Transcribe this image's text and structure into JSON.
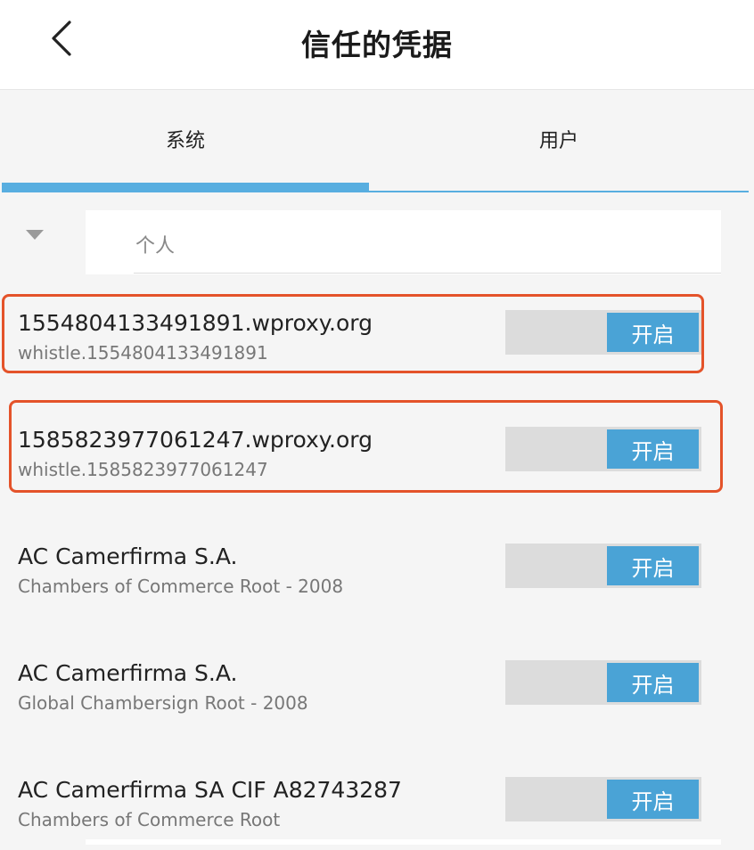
{
  "header": {
    "title": "信任的凭据"
  },
  "tabs": [
    {
      "label": "系统",
      "active": true
    },
    {
      "label": "用户",
      "active": false
    }
  ],
  "section": {
    "label": "个人"
  },
  "certificates": [
    {
      "title": "1554804133491891.wproxy.org",
      "subtitle": "whistle.1554804133491891",
      "switch_label": "开启",
      "highlighted": true
    },
    {
      "title": "1585823977061247.wproxy.org",
      "subtitle": "whistle.1585823977061247",
      "switch_label": "开启",
      "highlighted": true
    },
    {
      "title": "AC Camerfirma S.A.",
      "subtitle": "Chambers of Commerce Root - 2008",
      "switch_label": "开启",
      "highlighted": false
    },
    {
      "title": "AC Camerfirma S.A.",
      "subtitle": "Global Chambersign Root - 2008",
      "switch_label": "开启",
      "highlighted": false
    },
    {
      "title": "AC Camerfirma SA CIF A82743287",
      "subtitle": "Chambers of Commerce Root",
      "switch_label": "开启",
      "highlighted": false
    }
  ],
  "colors": {
    "accent": "#4aa3d6",
    "highlight": "#e4532a",
    "switch_track": "#dcdcdc"
  }
}
